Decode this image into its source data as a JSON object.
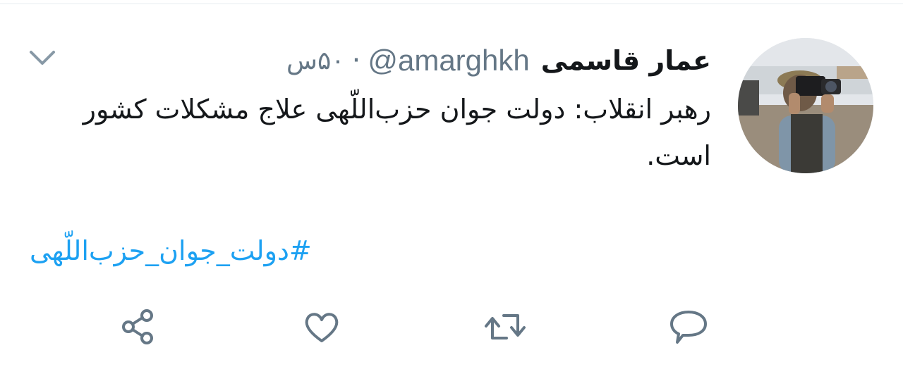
{
  "tweet": {
    "display_name": "عمار قاسمی",
    "handle": "@amarghkh",
    "separator": "·",
    "time": "۵۰س",
    "text": "رهبر انقلاب: دولت جوان حزب‌اللّهی علاج مشکلات کشور است.",
    "hashtag": "#دولت_جوان_حزب‌اللّهی"
  },
  "icons": {
    "menu": "chevron-down-icon",
    "share": "share-icon",
    "like": "heart-icon",
    "retweet": "retweet-icon",
    "reply": "reply-icon"
  },
  "colors": {
    "link": "#1da1f2",
    "text": "#14171a",
    "secondary": "#657786",
    "icon": "#657786"
  }
}
